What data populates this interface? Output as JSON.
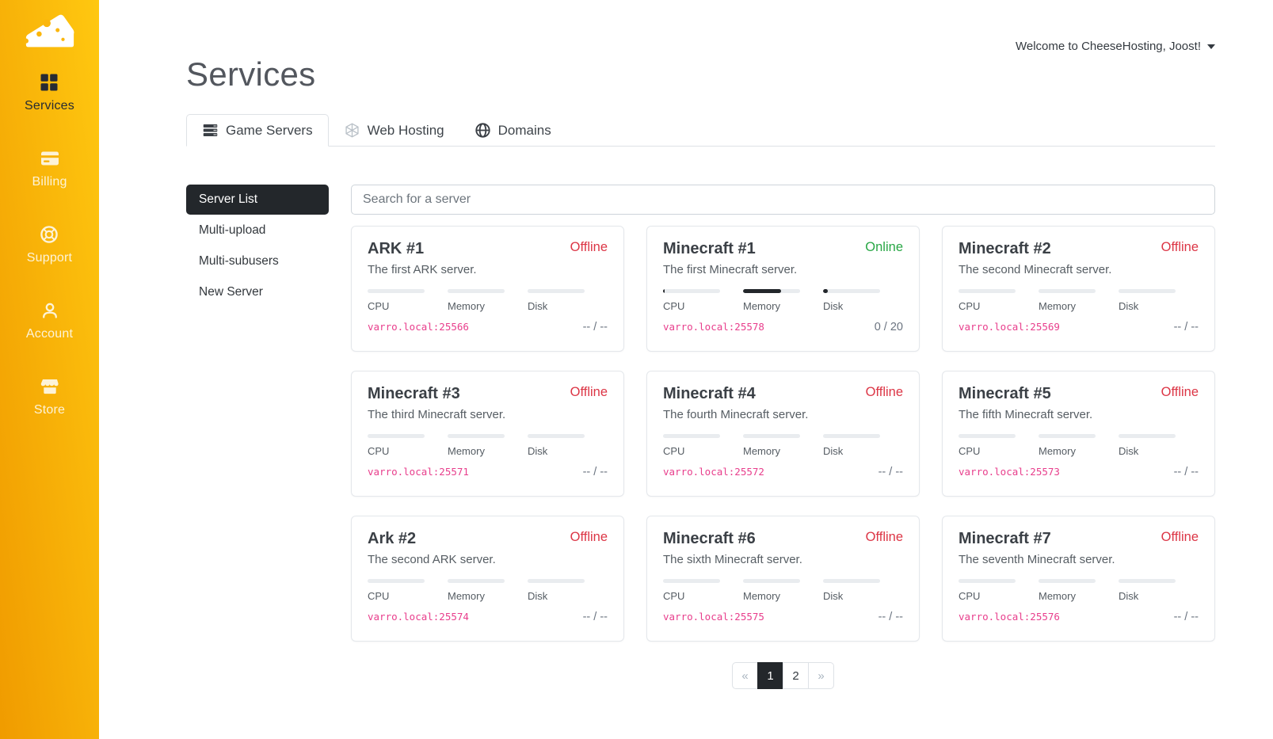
{
  "colors": {
    "sidebar_top": "#ffc810",
    "sidebar_bottom": "#f09b00",
    "active_dark": "#23272b",
    "offline": "#dc3545",
    "online": "#28a745",
    "address_pink": "#e83e8c"
  },
  "sidebar": {
    "items": [
      {
        "label": "Services",
        "icon": "grid-icon",
        "active": true
      },
      {
        "label": "Billing",
        "icon": "credit-card-icon",
        "active": false
      },
      {
        "label": "Support",
        "icon": "life-ring-icon",
        "active": false
      },
      {
        "label": "Account",
        "icon": "user-icon",
        "active": false
      },
      {
        "label": "Store",
        "icon": "storefront-icon",
        "active": false
      }
    ]
  },
  "header": {
    "welcome": "Welcome to CheeseHosting, Joost!"
  },
  "page": {
    "title": "Services"
  },
  "tabs": [
    {
      "label": "Game Servers",
      "icon": "server-rack-icon",
      "active": true
    },
    {
      "label": "Web Hosting",
      "icon": "hexagon-web-icon",
      "active": false
    },
    {
      "label": "Domains",
      "icon": "globe-icon",
      "active": false
    }
  ],
  "subnav": [
    {
      "label": "Server List",
      "active": true
    },
    {
      "label": "Multi-upload",
      "active": false
    },
    {
      "label": "Multi-subusers",
      "active": false
    },
    {
      "label": "New Server",
      "active": false
    }
  ],
  "search": {
    "placeholder": "Search for a server"
  },
  "bars": {
    "labels": [
      "CPU",
      "Memory",
      "Disk"
    ]
  },
  "cards": [
    {
      "title": "ARK #1",
      "status": "Offline",
      "status_class": "status-offline",
      "description": "The first ARK server.",
      "address": "varro.local:25566",
      "players": "-- / --",
      "usage": {
        "cpu": 0,
        "memory": 0,
        "disk": 0
      }
    },
    {
      "title": "Minecraft #1",
      "status": "Online",
      "status_class": "status-online",
      "description": "The first Minecraft server.",
      "address": "varro.local:25578",
      "players": "0 / 20",
      "usage": {
        "cpu": 3,
        "memory": 67,
        "disk": 8
      }
    },
    {
      "title": "Minecraft #2",
      "status": "Offline",
      "status_class": "status-offline",
      "description": "The second Minecraft server.",
      "address": "varro.local:25569",
      "players": "-- / --",
      "usage": {
        "cpu": 0,
        "memory": 0,
        "disk": 0
      }
    },
    {
      "title": "Minecraft #3",
      "status": "Offline",
      "status_class": "status-offline",
      "description": "The third Minecraft server.",
      "address": "varro.local:25571",
      "players": "-- / --",
      "usage": {
        "cpu": 0,
        "memory": 0,
        "disk": 0
      }
    },
    {
      "title": "Minecraft #4",
      "status": "Offline",
      "status_class": "status-offline",
      "description": "The fourth Minecraft server.",
      "address": "varro.local:25572",
      "players": "-- / --",
      "usage": {
        "cpu": 0,
        "memory": 0,
        "disk": 0
      }
    },
    {
      "title": "Minecraft #5",
      "status": "Offline",
      "status_class": "status-offline",
      "description": "The fifth Minecraft server.",
      "address": "varro.local:25573",
      "players": "-- / --",
      "usage": {
        "cpu": 0,
        "memory": 0,
        "disk": 0
      }
    },
    {
      "title": "Ark #2",
      "status": "Offline",
      "status_class": "status-offline",
      "description": "The second ARK server.",
      "address": "varro.local:25574",
      "players": "-- / --",
      "usage": {
        "cpu": 0,
        "memory": 0,
        "disk": 0
      }
    },
    {
      "title": "Minecraft #6",
      "status": "Offline",
      "status_class": "status-offline",
      "description": "The sixth Minecraft server.",
      "address": "varro.local:25575",
      "players": "-- / --",
      "usage": {
        "cpu": 0,
        "memory": 0,
        "disk": 0
      }
    },
    {
      "title": "Minecraft #7",
      "status": "Offline",
      "status_class": "status-offline",
      "description": "The seventh Minecraft server.",
      "address": "varro.local:25576",
      "players": "-- / --",
      "usage": {
        "cpu": 0,
        "memory": 0,
        "disk": 0
      }
    }
  ],
  "pagination": {
    "prev": "«",
    "pages": [
      "1",
      "2"
    ],
    "next": "»"
  }
}
